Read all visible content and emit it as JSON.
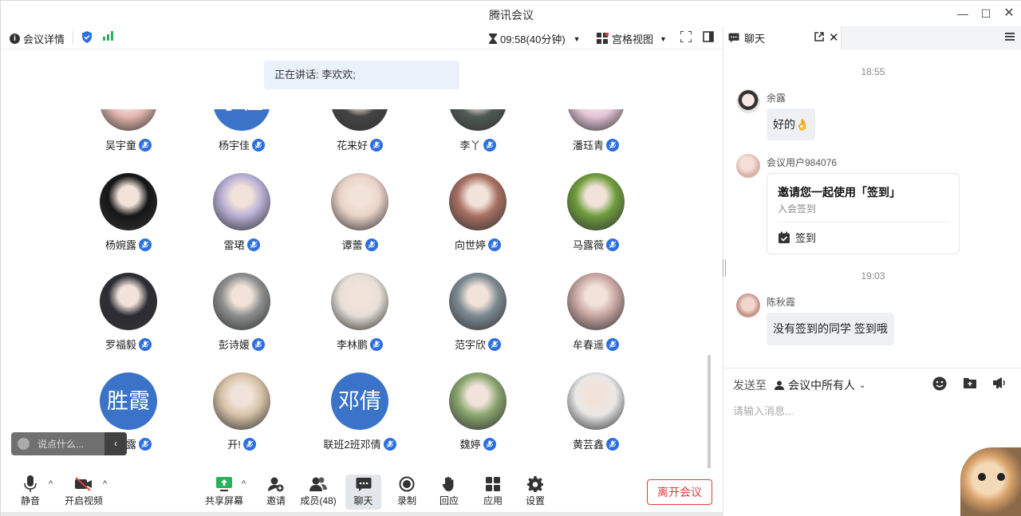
{
  "window": {
    "title": "腾讯会议"
  },
  "toolbar": {
    "meeting_details": "会议详情",
    "timer": "09:58(40分钟)",
    "view_mode": "宫格视图"
  },
  "speaking": "正在讲话: 李欢欢;",
  "participants": [
    {
      "name": "吴宇童",
      "avatar": "photo",
      "color": "#e8b8b0"
    },
    {
      "name": "杨宇佳",
      "avatar": "text",
      "text": "宇佳",
      "color": "#3a73c8"
    },
    {
      "name": "花来好",
      "avatar": "photo",
      "color": "#444444"
    },
    {
      "name": "李丫",
      "avatar": "photo",
      "color": "#4f5a55"
    },
    {
      "name": "潘珏青",
      "avatar": "photo",
      "color": "#e6c7d9"
    },
    {
      "name": "杨婉露",
      "avatar": "photo",
      "color": "#151515"
    },
    {
      "name": "雷珺",
      "avatar": "photo",
      "color": "#b9b0d6"
    },
    {
      "name": "谭蕾",
      "avatar": "photo",
      "color": "#e9d3c8"
    },
    {
      "name": "向世婷",
      "avatar": "photo",
      "color": "#a86f63"
    },
    {
      "name": "马露薇",
      "avatar": "photo",
      "color": "#6f9d3d"
    },
    {
      "name": "罗福毅",
      "avatar": "photo",
      "color": "#2c2c33"
    },
    {
      "name": "彭诗媛",
      "avatar": "photo",
      "color": "#8c8f8e"
    },
    {
      "name": "李林鹏",
      "avatar": "photo",
      "color": "#e7e0d8"
    },
    {
      "name": "范宇欣",
      "avatar": "photo",
      "color": "#7d8a92"
    },
    {
      "name": "牟春遥",
      "avatar": "photo",
      "color": "#c9a7a2"
    },
    {
      "name": "叶胜露",
      "avatar": "text",
      "text": "胜霞",
      "color": "#3a73c8"
    },
    {
      "name": "开!",
      "avatar": "photo",
      "color": "#d8c3a8"
    },
    {
      "name": "联班2班邓倩",
      "avatar": "text",
      "text": "邓倩",
      "color": "#3a73c8"
    },
    {
      "name": "魏婷",
      "avatar": "photo",
      "color": "#8aa66f"
    },
    {
      "name": "黄芸鑫",
      "avatar": "photo",
      "color": "#e8e8e8"
    }
  ],
  "float_input": {
    "placeholder": "说点什么..."
  },
  "bottom": {
    "mute": "静音",
    "video": "开启视频",
    "share": "共享屏幕",
    "invite": "邀请",
    "members": "成员(48)",
    "chat": "聊天",
    "record": "录制",
    "reaction": "回应",
    "apps": "应用",
    "settings": "设置",
    "leave": "离开会议"
  },
  "chat": {
    "tab": "聊天",
    "time1": "18:55",
    "msg1": {
      "name": "余露",
      "text": "好的👌"
    },
    "msg2": {
      "name": "会议用户984076",
      "card_title": "邀请您一起使用「签到」",
      "card_sub": "入会签到",
      "card_button": "签到"
    },
    "time2": "19:03",
    "msg3": {
      "name": "陈秋霞",
      "text": "没有签到的同学 签到哦"
    },
    "send_to_label": "发送至",
    "send_to": "会议中所有人",
    "input_placeholder": "请输入消息..."
  },
  "colors": {
    "accent": "#2d6fe0",
    "leave": "#e23c3c",
    "signal": "#27b35a"
  }
}
